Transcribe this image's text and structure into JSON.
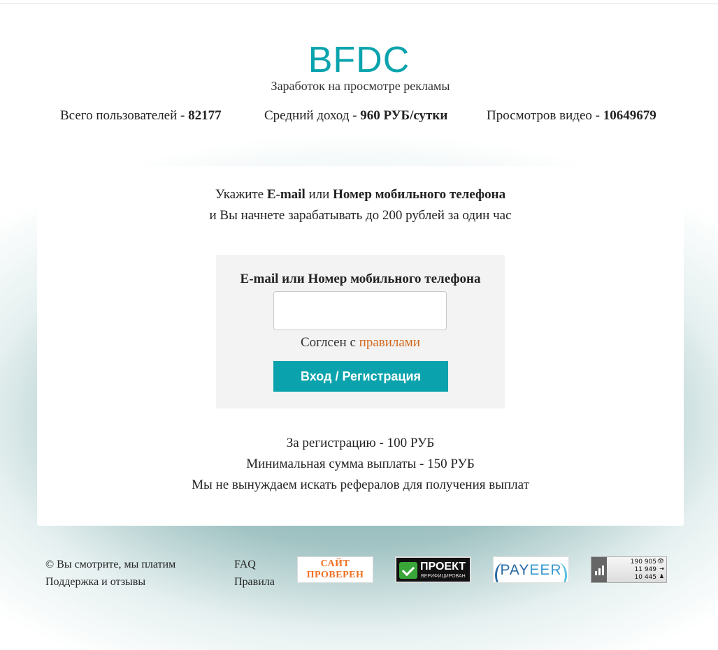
{
  "header": {
    "logo": "BFDC",
    "tagline": "Заработок на просмотре рекламы"
  },
  "stats": {
    "users_label": "Всего пользователей - ",
    "users_value": "82177",
    "income_label": "Средний доход - ",
    "income_value": "960 РУБ/сутки",
    "views_label": "Просмотров видео - ",
    "views_value": "10649679"
  },
  "intro": {
    "prefix": "Укажите ",
    "email": "E-mail",
    "or": " или ",
    "phone": "Номер мобильного телефона",
    "line2": "и Вы начнете зарабатывать до 200 рублей за один час"
  },
  "form": {
    "label": "E-mail или Номер мобильного телефона",
    "input_value": "",
    "agree_prefix": "Соглсен с ",
    "agree_link": "правилами",
    "submit": "Вход / Регистрация"
  },
  "info": [
    "За регистрацию - 100 РУБ",
    "Минимальная сумма выплаты - 150 РУБ",
    "Мы не вынуждаем искать рефералов для получения выплат"
  ],
  "footer": {
    "copyright": "© Вы смотрите, мы платим",
    "support": "Поддержка и отзывы",
    "faq": "FAQ",
    "rules": "Правила"
  },
  "badges": {
    "checked": {
      "line1": "САЙТ",
      "line2": "ПРОВЕРЕН",
      "icon": "site-checked-badge"
    },
    "project": {
      "title": "ПРОЕКТ",
      "subtitle": "ВЕРИФИЦИРОВАН",
      "icon": "checkmark-icon"
    },
    "payeer": {
      "part1": "PAY",
      "part2": "EER"
    },
    "counter": {
      "views": "190 905",
      "visitors": "11 949",
      "hosts": "10 445",
      "icon": "bar-chart-icon"
    }
  },
  "colors": {
    "brand": "#0aa3ad",
    "link": "#d2691e"
  }
}
